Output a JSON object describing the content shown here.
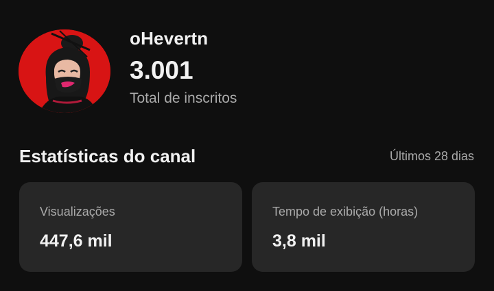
{
  "channel": {
    "name": "oHevertn",
    "subscriber_count": "3.001",
    "subscriber_label": "Total de inscritos"
  },
  "stats": {
    "title": "Estatísticas do canal",
    "period": "Últimos 28 dias",
    "cards": [
      {
        "label": "Visualizações",
        "value": "447,6 mil"
      },
      {
        "label": "Tempo de exibição (horas)",
        "value": "3,8 mil"
      }
    ]
  },
  "colors": {
    "background": "#0f0f0f",
    "card": "#272727",
    "avatar_bg": "#d81414",
    "text_primary": "#f1f1f1",
    "text_secondary": "#aaaaaa"
  }
}
